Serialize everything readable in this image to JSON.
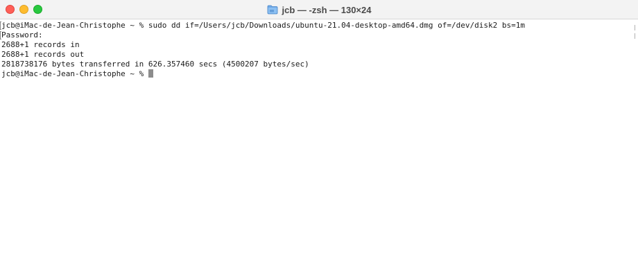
{
  "window": {
    "title": "jcb — -zsh — 130×24",
    "title_icon": "folder-icon",
    "colors": {
      "close": "#ff5f57",
      "minimize": "#febc2e",
      "zoom": "#28c840",
      "cursor": "#8c8c8c",
      "text": "#1a1a1a"
    }
  },
  "terminal": {
    "lines": [
      "jcb@iMac-de-Jean-Christophe ~ % sudo dd if=/Users/jcb/Downloads/ubuntu-21.04-desktop-amd64.dmg of=/dev/disk2 bs=1m",
      "Password:",
      "2688+1 records in",
      "2688+1 records out",
      "2818738176 bytes transferred in 626.357460 secs (4500207 bytes/sec)",
      "jcb@iMac-de-Jean-Christophe ~ % "
    ]
  }
}
